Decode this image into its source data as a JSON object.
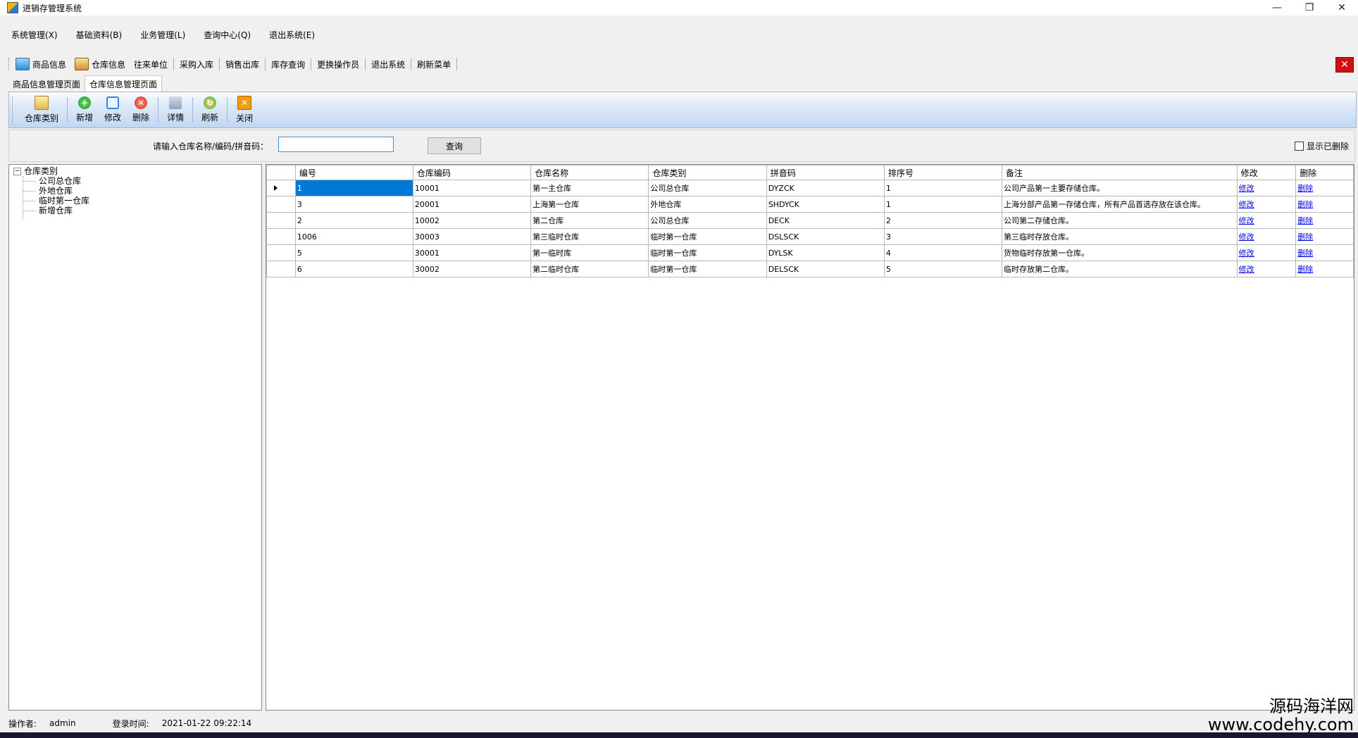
{
  "window": {
    "title": "进销存管理系统",
    "controls": [
      "—",
      "❐",
      "✕"
    ]
  },
  "menu": [
    "系统管理(X)",
    "基础资料(B)",
    "业务管理(L)",
    "查询中心(Q)",
    "退出系统(E)"
  ],
  "toolbar": {
    "items": [
      "商品信息",
      "仓库信息",
      "往来单位",
      "采购入库",
      "销售出库",
      "库存查询",
      "更换操作员",
      "退出系统",
      "刷新菜单"
    ],
    "close": "✕"
  },
  "page_tabs": [
    "商品信息管理页面",
    "仓库信息管理页面"
  ],
  "ribbon": {
    "buttons": [
      "仓库类别",
      "新增",
      "修改",
      "删除",
      "详情",
      "刷新",
      "关闭"
    ]
  },
  "search": {
    "label": "请输入仓库名称/编码/拼音码：",
    "value": "",
    "button": "查询",
    "show_deleted": "显示已删除"
  },
  "tree": {
    "root": "仓库类别",
    "children": [
      "公司总仓库",
      "外地仓库",
      "临时第一仓库",
      "新增仓库"
    ]
  },
  "grid": {
    "columns": [
      "编号",
      "仓库编码",
      "仓库名称",
      "仓库类别",
      "拼音码",
      "排序号",
      "备注",
      "修改",
      "删除"
    ],
    "rows": [
      [
        "1",
        "10001",
        "第一主仓库",
        "公司总仓库",
        "DYZCK",
        "1",
        "公司产品第一主要存储仓库。",
        "修改",
        "删除"
      ],
      [
        "3",
        "20001",
        "上海第一仓库",
        "外地仓库",
        "SHDYCK",
        "1",
        "上海分部产品第一存储仓库，所有产品首选存放在该仓库。",
        "修改",
        "删除"
      ],
      [
        "2",
        "10002",
        "第二仓库",
        "公司总仓库",
        "DECK",
        "2",
        "公司第二存储仓库。",
        "修改",
        "删除"
      ],
      [
        "1006",
        "30003",
        "第三临时仓库",
        "临时第一仓库",
        "DSLSCK",
        "3",
        "第三临时存放仓库。",
        "修改",
        "删除"
      ],
      [
        "5",
        "30001",
        "第一临时库",
        "临时第一仓库",
        "DYLSK",
        "4",
        "货物临时存放第一仓库。",
        "修改",
        "删除"
      ],
      [
        "6",
        "30002",
        "第二临时仓库",
        "临时第一仓库",
        "DELSCK",
        "5",
        "临时存放第二仓库。",
        "修改",
        "删除"
      ]
    ]
  },
  "status": {
    "operator_label": "操作者:",
    "operator": "admin",
    "login_label": "登录时间:",
    "login_time": "2021-01-22 09:22:14"
  },
  "watermark": {
    "line1": "源码海洋网",
    "line2": "www.codehy.com"
  }
}
